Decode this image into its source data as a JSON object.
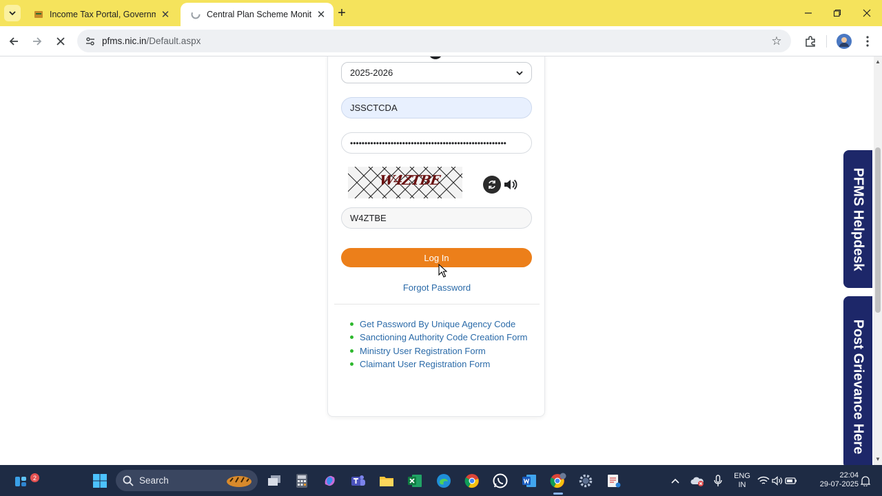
{
  "browser": {
    "tabs": [
      {
        "title": "Income Tax Portal, Government",
        "active": false
      },
      {
        "title": "Central Plan Scheme Monitorin",
        "active": true
      }
    ],
    "url_host": "pfms.nic.in",
    "url_path": "/Default.aspx"
  },
  "login": {
    "financial_year": "2025-2026",
    "username": "JSSCTCDA",
    "password_mask": "••••••••••••••••••••••••••••••••••••••••••••••••••••••",
    "captcha_image_text": "W4ZTBE",
    "captcha_value": "W4ZTBE",
    "login_label": "Log In",
    "forgot_label": "Forgot Password",
    "links": [
      "Get Password By Unique Agency Code",
      "Sanctioning Authority Code Creation Form",
      "Ministry User Registration Form",
      "Claimant User Registration Form"
    ]
  },
  "side_tabs": {
    "helpdesk": "PFMS Helpdesk",
    "grievance": "Post Grievance Here"
  },
  "taskbar": {
    "search_label": "Search",
    "widgets_badge": "2",
    "lang_line1": "ENG",
    "lang_line2": "IN",
    "time": "22:04",
    "date": "29-07-2025"
  },
  "colors": {
    "tab_strip": "#f5e35c",
    "login_button": "#ec7f1a",
    "link_color": "#2a6aa8",
    "side_tab": "#1d2769",
    "taskbar": "#1e2b44"
  }
}
